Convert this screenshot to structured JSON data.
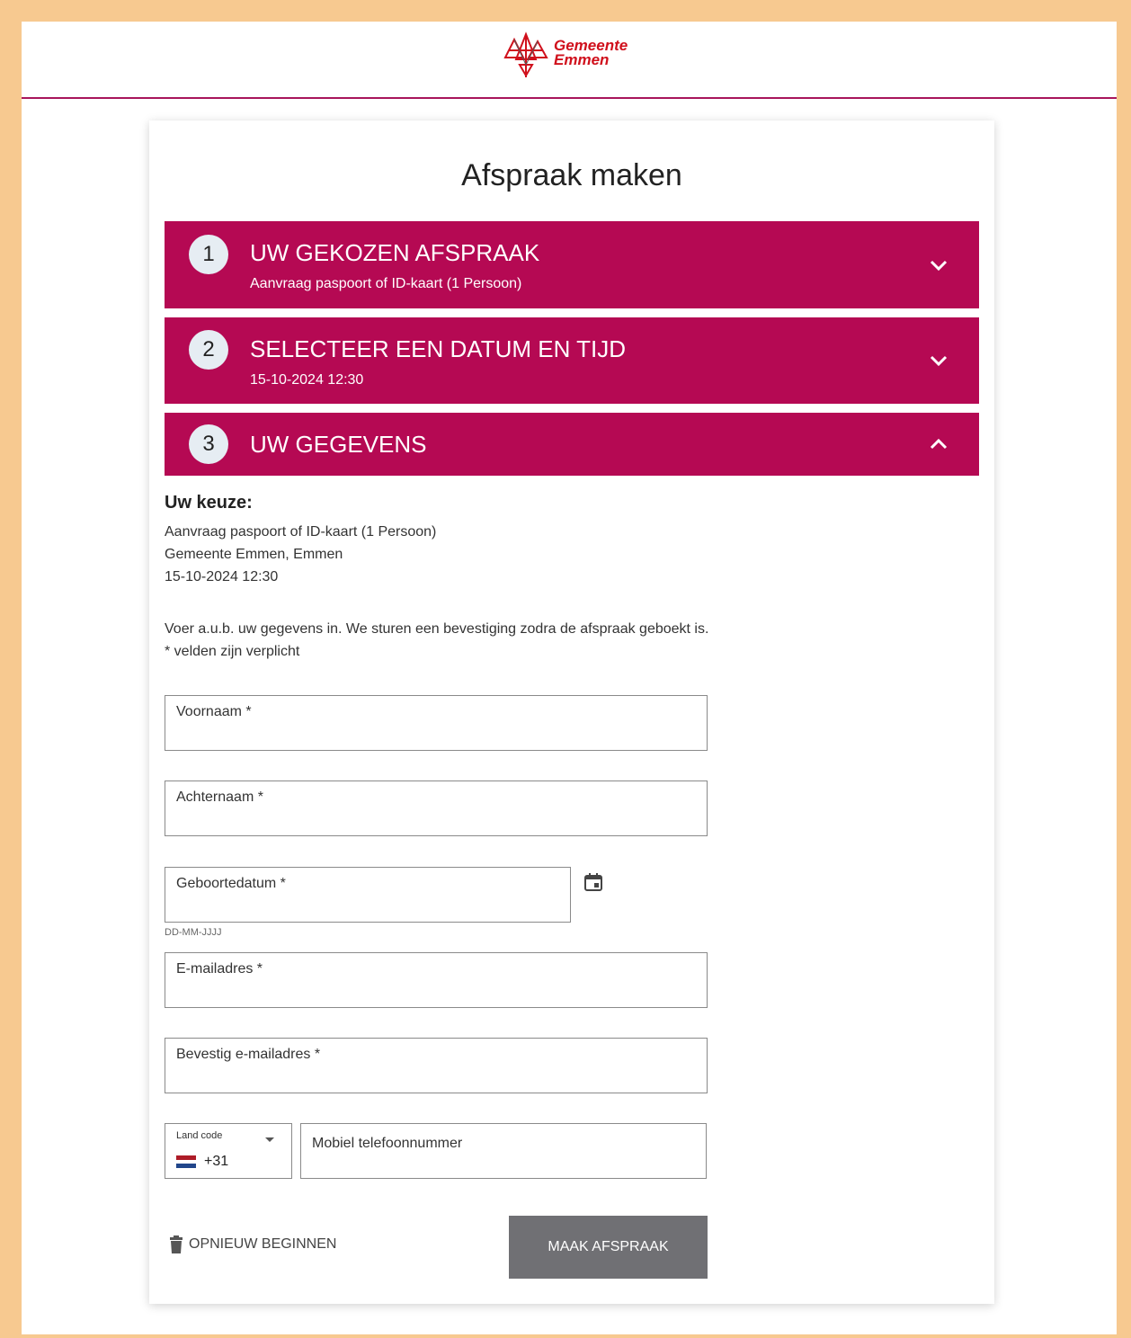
{
  "header": {
    "logo_text_1": "Gemeente",
    "logo_text_2": "Emmen"
  },
  "page": {
    "title": "Afspraak maken"
  },
  "steps": [
    {
      "number": "1",
      "title": "UW GEKOZEN AFSPRAAK",
      "subtitle": "Aanvraag paspoort of ID-kaart (1 Persoon)",
      "state": "collapsed"
    },
    {
      "number": "2",
      "title": "SELECTEER EEN DATUM EN TIJD",
      "subtitle": "15-10-2024 12:30",
      "state": "collapsed"
    },
    {
      "number": "3",
      "title": "UW GEGEVENS",
      "state": "expanded"
    }
  ],
  "choice": {
    "heading": "Uw keuze:",
    "service": "Aanvraag paspoort of ID-kaart (1 Persoon)",
    "location": "Gemeente Emmen, Emmen",
    "datetime": "15-10-2024 12:30"
  },
  "instructions": {
    "line1": "Voer a.u.b. uw gegevens in. We sturen een bevestiging zodra de afspraak geboekt is.",
    "line2": "* velden zijn verplicht"
  },
  "form": {
    "first_name": {
      "label": "Voornaam *",
      "value": ""
    },
    "last_name": {
      "label": "Achternaam *",
      "value": ""
    },
    "birthdate": {
      "label": "Geboortedatum *",
      "value": "",
      "hint": "DD-MM-JJJJ"
    },
    "email": {
      "label": "E-mailadres *",
      "value": ""
    },
    "email_confirm": {
      "label": "Bevestig e-mailadres *",
      "value": ""
    },
    "country_code": {
      "label": "Land code",
      "value": "+31"
    },
    "mobile": {
      "label": "Mobiel telefoonnummer",
      "value": ""
    }
  },
  "actions": {
    "reset_label": "OPNIEUW BEGINNEN",
    "submit_label": "MAAK AFSPRAAK"
  },
  "colors": {
    "brand": "#b50953",
    "page_border": "#f7c990",
    "submit_bg": "#707074",
    "logo_red": "#d0101c"
  },
  "icons": {
    "logo": "gemeente-emmen-logo",
    "step_collapsed": "chevron-down-icon",
    "step_expanded": "chevron-up-icon",
    "calendar": "calendar-icon",
    "dropdown": "caret-down-icon",
    "flag": "netherlands-flag-icon",
    "trash": "trash-icon"
  }
}
